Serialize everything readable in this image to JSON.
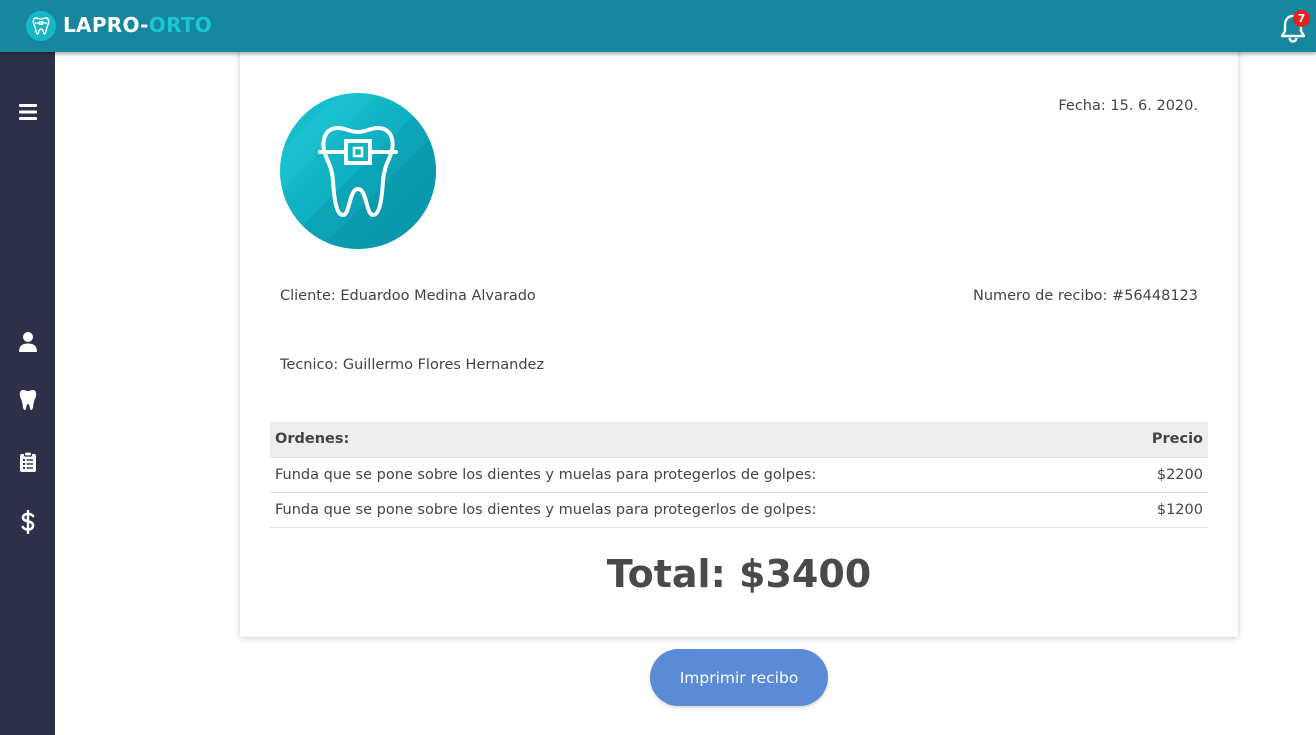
{
  "header": {
    "brand_part1": "LAPRO-",
    "brand_part2": "ORTO",
    "notification_count": "7",
    "icons": [
      "tooth-logo-icon",
      "bell-icon"
    ]
  },
  "sidebar": {
    "items": [
      {
        "icon": "menu-icon"
      },
      {
        "icon": "user-icon"
      },
      {
        "icon": "tooth-icon"
      },
      {
        "icon": "clipboard-icon"
      },
      {
        "icon": "dollar-icon"
      }
    ]
  },
  "receipt": {
    "fecha": "Fecha: 15. 6. 2020.",
    "cliente": "Cliente: Eduardoo Medina Alvarado",
    "numero": "Numero de recibo: #56448123",
    "tecnico": "Tecnico: Guillermo Flores Hernandez",
    "table": {
      "headers": [
        "Ordenes:",
        "Precio"
      ],
      "rows": [
        [
          "Funda que se pone sobre los dientes y muelas para protegerlos de golpes:",
          "$2200"
        ],
        [
          "Funda que se pone sobre los dientes y muelas para protegerlos de golpes:",
          "$1200"
        ]
      ]
    },
    "total": "Total: $3400"
  },
  "actions": {
    "print_label": "Imprimir recibo"
  },
  "colors": {
    "topbar": "#17869f",
    "sidebar": "#2e3049",
    "accent": "#16b7c6",
    "button": "#5b8bd6",
    "badge": "#e62020"
  }
}
